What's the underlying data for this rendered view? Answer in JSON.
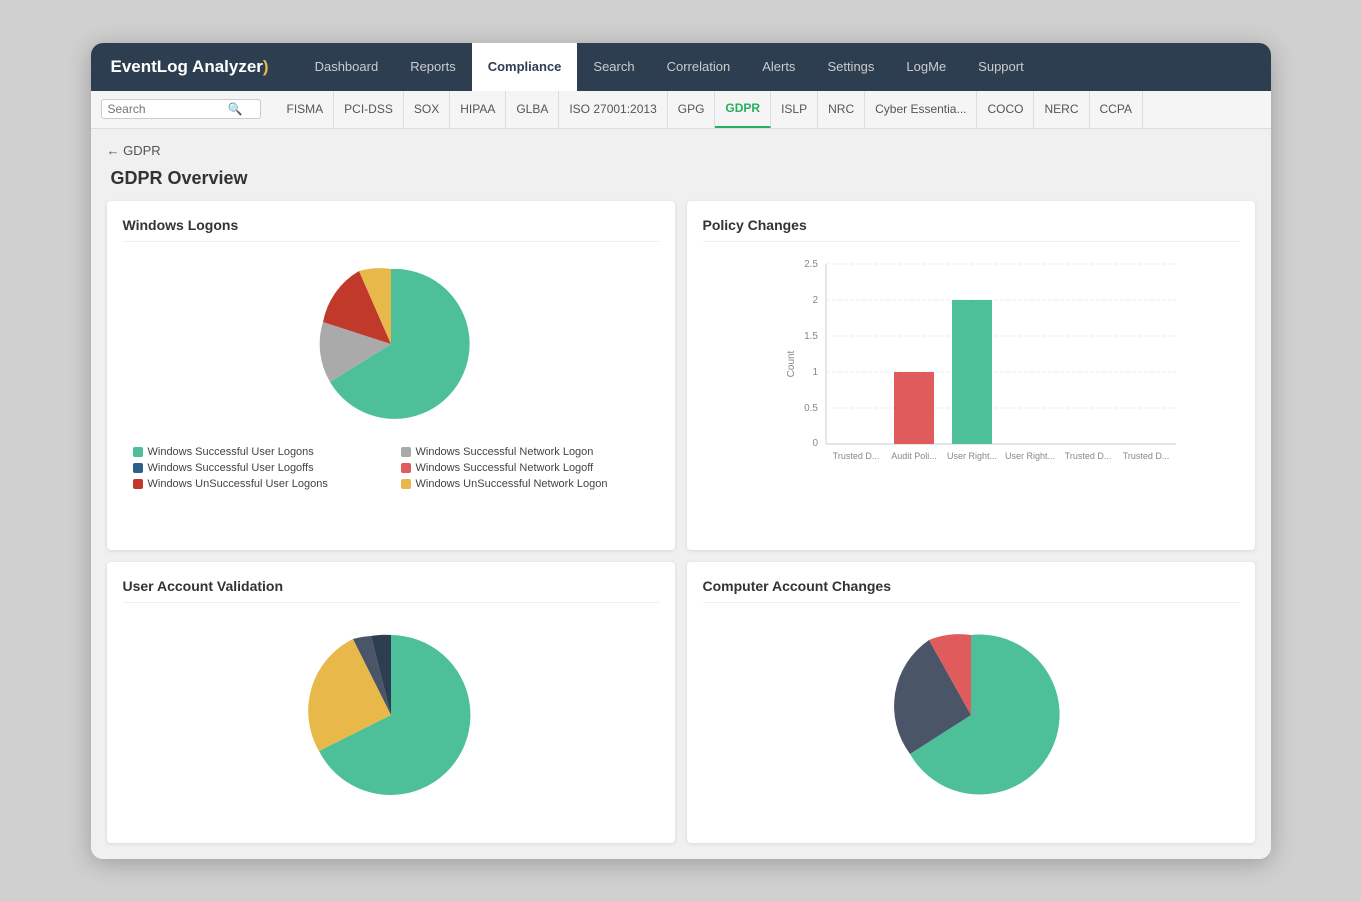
{
  "app": {
    "logo_text": "EventLog Analyzer",
    "logo_symbol": ")"
  },
  "nav": {
    "items": [
      {
        "label": "Dashboard",
        "active": false
      },
      {
        "label": "Reports",
        "active": false
      },
      {
        "label": "Compliance",
        "active": true
      },
      {
        "label": "Search",
        "active": false
      },
      {
        "label": "Correlation",
        "active": false
      },
      {
        "label": "Alerts",
        "active": false
      },
      {
        "label": "Settings",
        "active": false
      },
      {
        "label": "LogMe",
        "active": false
      },
      {
        "label": "Support",
        "active": false
      }
    ]
  },
  "sub_nav": {
    "search_placeholder": "Search",
    "items": [
      {
        "label": "FISMA",
        "active": false
      },
      {
        "label": "PCI-DSS",
        "active": false
      },
      {
        "label": "SOX",
        "active": false
      },
      {
        "label": "HIPAA",
        "active": false
      },
      {
        "label": "GLBA",
        "active": false
      },
      {
        "label": "ISO 27001:2013",
        "active": false
      },
      {
        "label": "GPG",
        "active": false
      },
      {
        "label": "GDPR",
        "active": true
      },
      {
        "label": "ISLP",
        "active": false
      },
      {
        "label": "NRC",
        "active": false
      },
      {
        "label": "Cyber Essentia...",
        "active": false
      },
      {
        "label": "COCO",
        "active": false
      },
      {
        "label": "NERC",
        "active": false
      },
      {
        "label": "CCPA",
        "active": false
      }
    ]
  },
  "breadcrumb": {
    "back_label": "← GDPR"
  },
  "page": {
    "title": "GDPR Overview"
  },
  "cards": {
    "windows_logons": {
      "title": "Windows Logons",
      "legend": [
        {
          "label": "Windows Successful User Logons",
          "color": "#4dbf99"
        },
        {
          "label": "Windows Successful Network Logon",
          "color": "#aaaaaa"
        },
        {
          "label": "Windows Successful User Logoffs",
          "color": "#2c5f8a"
        },
        {
          "label": "Windows Successful Network Logoff",
          "color": "#e05c5c"
        },
        {
          "label": "Windows UnSuccessful User Logons",
          "color": "#c0392b"
        },
        {
          "label": "Windows UnSuccessful Network Logon",
          "color": "#e8b84b"
        }
      ]
    },
    "policy_changes": {
      "title": "Policy Changes",
      "y_label": "Count",
      "y_values": [
        0,
        0.5,
        1,
        1.5,
        2,
        2.5
      ],
      "bars": [
        {
          "label": "Trusted D...",
          "value": 0,
          "color": "#4dbf99"
        },
        {
          "label": "Audit Poli...",
          "value": 1,
          "color": "#e05c5c"
        },
        {
          "label": "User Right...",
          "value": 2,
          "color": "#4dbf99"
        },
        {
          "label": "User Right...",
          "value": 0,
          "color": "#4dbf99"
        },
        {
          "label": "Trusted D...",
          "value": 0,
          "color": "#4dbf99"
        },
        {
          "label": "Trusted D...",
          "value": 0,
          "color": "#4dbf99"
        }
      ]
    },
    "user_account": {
      "title": "User Account Validation"
    },
    "computer_account": {
      "title": "Computer Account Changes"
    }
  },
  "colors": {
    "teal": "#4dbf99",
    "gray": "#aaaaaa",
    "dark_blue": "#2c5f8a",
    "red": "#c0392b",
    "orange_red": "#e05c5c",
    "yellow": "#e8b84b",
    "dark_gray": "#4a5568"
  }
}
